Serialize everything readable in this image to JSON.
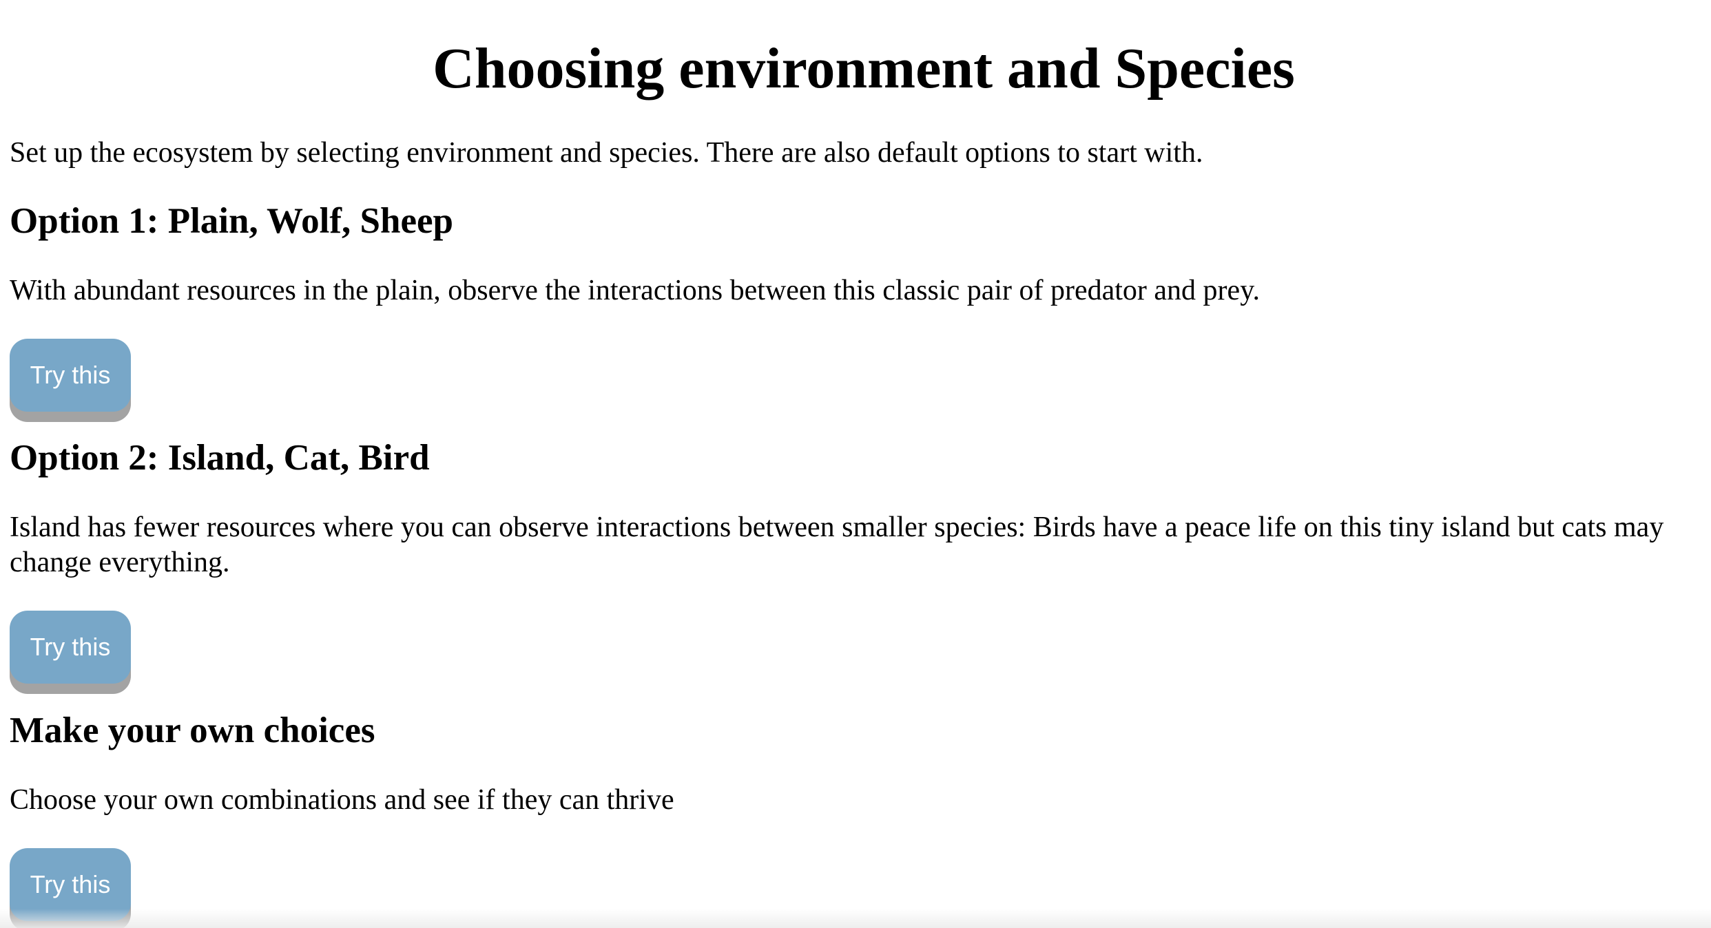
{
  "page": {
    "title": "Choosing environment and Species",
    "intro": "Set up the ecosystem by selecting environment and species. There are also default options to start with."
  },
  "options": [
    {
      "heading": "Option 1: Plain, Wolf, Sheep",
      "description": "With abundant resources in the plain, observe the interactions between this classic pair of predator and prey.",
      "button_label": "Try this"
    },
    {
      "heading": "Option 2: Island, Cat, Bird",
      "description": "Island has fewer resources where you can observe interactions between smaller species: Birds have a peace life on this tiny island but cats may change everything.",
      "button_label": "Try this"
    },
    {
      "heading": "Make your own choices",
      "description": "Choose your own combinations and see if they can thrive",
      "button_label": "Try this"
    }
  ],
  "colors": {
    "button_bg": "#78a7c8",
    "button_shadow": "#a3a3a3",
    "button_text": "#ffffff"
  }
}
